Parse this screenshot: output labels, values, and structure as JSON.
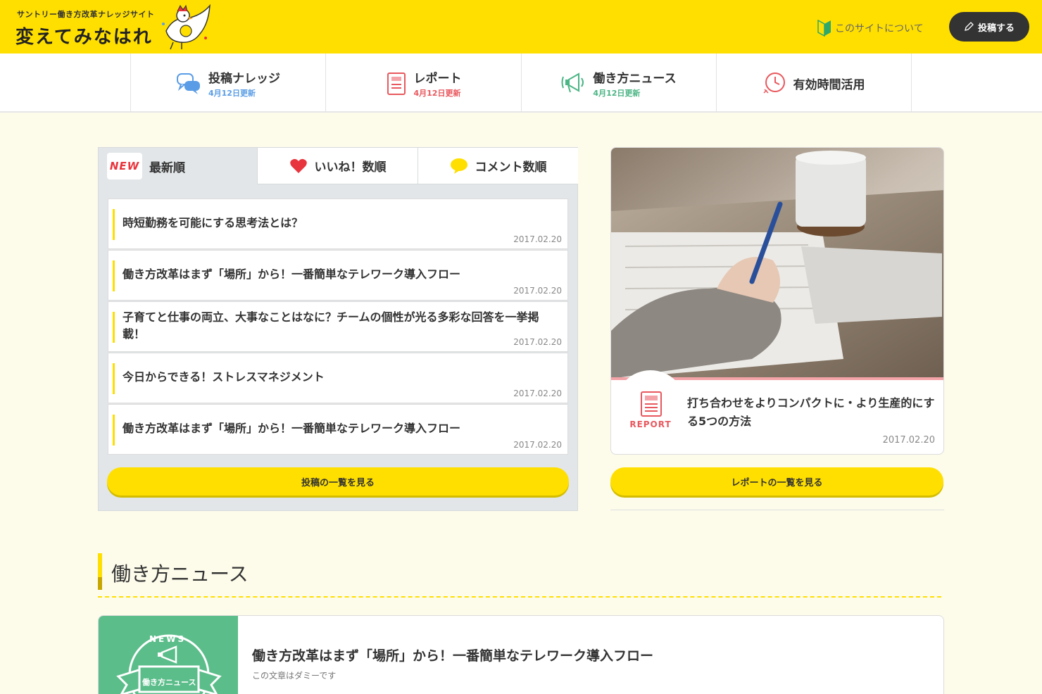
{
  "header": {
    "subtitle": "サントリー働き方改革ナレッジサイト",
    "title": "変えてみなはれ",
    "about_label": "このサイトについて",
    "post_label": "投稿する"
  },
  "nav": {
    "items": [
      {
        "label": "投稿ナレッジ",
        "date": "4月12日更新",
        "color": "#5a9de6"
      },
      {
        "label": "レポート",
        "date": "4月12日更新",
        "color": "#e8585e"
      },
      {
        "label": "働き方ニュース",
        "date": "4月12日更新",
        "color": "#4cb585"
      },
      {
        "label": "有効時間活用",
        "date": "",
        "color": "#e8585e"
      }
    ]
  },
  "ranking": {
    "tabs": [
      {
        "badge": "NEW",
        "label": "最新順"
      },
      {
        "label": "いいね！数順"
      },
      {
        "label": "コメント数順"
      }
    ],
    "posts": [
      {
        "title": "時短勤務を可能にする思考法とは？",
        "date": "2017.02.20"
      },
      {
        "title": "働き方改革はまず「場所」から！一番簡単なテレワーク導入フロー",
        "date": "2017.02.20"
      },
      {
        "title": "子育てと仕事の両立、大事なことはなに？チームの個性が光る多彩な回答を一挙掲載！",
        "date": "2017.02.20"
      },
      {
        "title": "今日からできる！ストレスマネジメント",
        "date": "2017.02.20"
      },
      {
        "title": "働き方改革はまず「場所」から！一番簡単なテレワーク導入フロー",
        "date": "2017.02.20"
      }
    ],
    "more_label": "投稿の一覧を見る"
  },
  "report": {
    "badge": "REPORT",
    "title": "打ち合わせをよりコンパクトに・より生産的にする5つの方法",
    "date": "2017.02.20",
    "more_label": "レポートの一覧を見る"
  },
  "news": {
    "section_title": "働き方ニュース",
    "thumb_text": "NEWS",
    "thumb_sub": "働き方ニュース",
    "title": "働き方改革はまず「場所」から！一番簡単なテレワーク導入フロー",
    "subtitle": "この文章はダミーです"
  },
  "colors": {
    "brand_yellow": "#ffdf00",
    "report_pink": "#e8585e",
    "news_green": "#5bbd8a",
    "knowledge_blue": "#5a9de6"
  }
}
